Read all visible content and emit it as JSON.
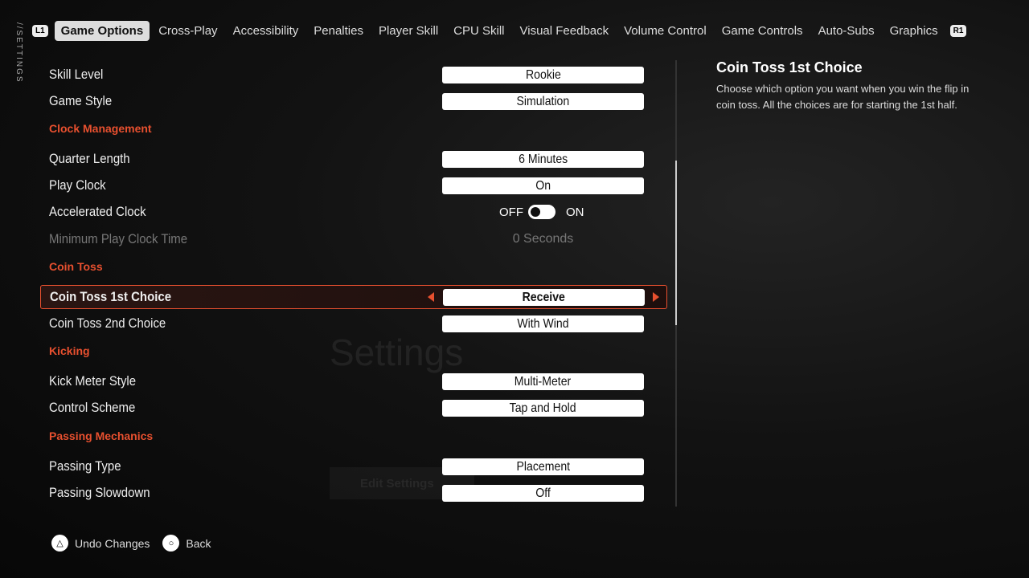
{
  "side_label": "//SETTINGS",
  "tabs": {
    "left_bumper": "L1",
    "right_bumper": "R1",
    "items": [
      "Game Options",
      "Cross-Play",
      "Accessibility",
      "Penalties",
      "Player Skill",
      "CPU Skill",
      "Visual Feedback",
      "Volume Control",
      "Game Controls",
      "Auto-Subs",
      "Graphics"
    ],
    "active": "Game Options"
  },
  "background": {
    "title": "Settings",
    "button": "Edit Settings"
  },
  "settings": {
    "skill_level": {
      "label": "Skill Level",
      "value": "Rookie"
    },
    "game_style": {
      "label": "Game Style",
      "value": "Simulation"
    },
    "clock_section": "Clock Management",
    "quarter_length": {
      "label": "Quarter Length",
      "value": "6 Minutes"
    },
    "play_clock": {
      "label": "Play Clock",
      "value": "On"
    },
    "accelerated_clock": {
      "label": "Accelerated Clock",
      "off": "OFF",
      "on": "ON",
      "state": "off"
    },
    "min_play_clock": {
      "label": "Minimum Play Clock Time",
      "value": "0 Seconds",
      "disabled": true
    },
    "coin_section": "Coin Toss",
    "coin_1st": {
      "label": "Coin Toss 1st Choice",
      "value": "Receive",
      "selected": true
    },
    "coin_2nd": {
      "label": "Coin Toss 2nd Choice",
      "value": "With Wind"
    },
    "kicking_section": "Kicking",
    "kick_meter": {
      "label": "Kick Meter Style",
      "value": "Multi-Meter"
    },
    "control_scheme": {
      "label": "Control Scheme",
      "value": "Tap and Hold"
    },
    "passing_section": "Passing Mechanics",
    "passing_type": {
      "label": "Passing Type",
      "value": "Placement"
    },
    "passing_slowdown": {
      "label": "Passing Slowdown",
      "value": "Off"
    }
  },
  "help": {
    "title": "Coin Toss 1st Choice",
    "description": "Choose which option you want when you win the flip in coin toss. All the choices are for starting the 1st half."
  },
  "footer": {
    "undo": "Undo Changes",
    "back": "Back"
  },
  "colors": {
    "accent": "#e8502f"
  }
}
